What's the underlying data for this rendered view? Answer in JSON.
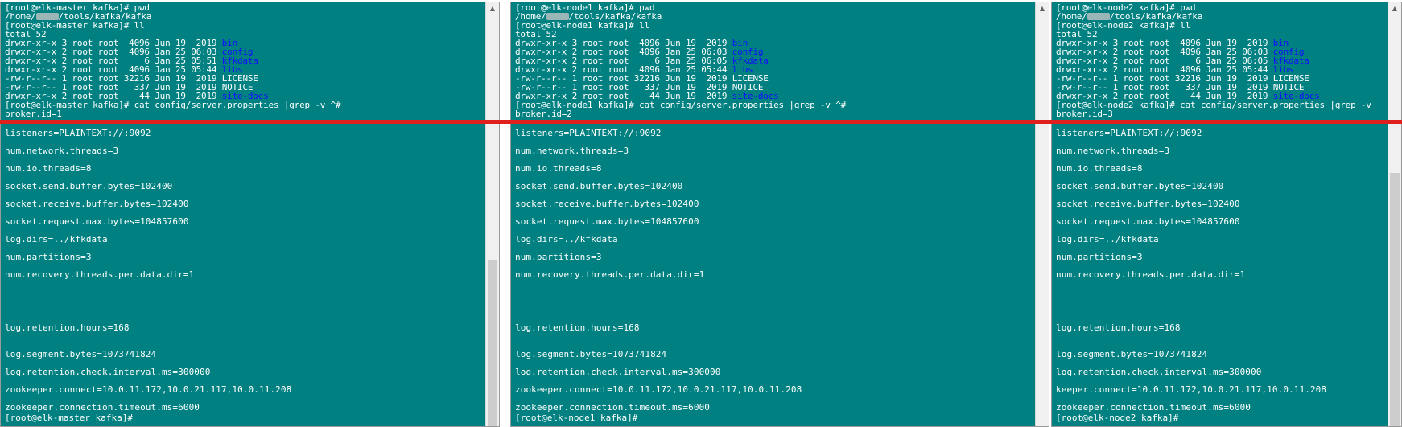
{
  "panes": [
    {
      "host": "elk-master",
      "header": [
        {
          "t": "[root@elk-master kafka]# pwd"
        },
        {
          "t": "/home/",
          "blur": true,
          "t2": "/tools/kafka/kafka"
        },
        {
          "t": "[root@elk-master kafka]# ll"
        },
        {
          "t": "total 52"
        },
        {
          "t": "drwxr-xr-x 3 root root  4096 Jun 19  2019 ",
          "name": "bin"
        },
        {
          "t": "drwxr-xr-x 2 root root  4096 Jan 25 06:03 ",
          "name": "config"
        },
        {
          "t": "drwxr-xr-x 2 root root     6 Jan 25 05:51 ",
          "name": "kfkdata"
        },
        {
          "t": "drwxr-xr-x 2 root root  4096 Jan 25 05:44 ",
          "name": "libs"
        },
        {
          "t": "-rw-r--r-- 1 root root 32216 Jun 19  2019 LICENSE"
        },
        {
          "t": "-rw-r--r-- 1 root root   337 Jun 19  2019 NOTICE"
        },
        {
          "t": "drwxr-xr-x 2 root root    44 Jun 19  2019 ",
          "name": "site-docs"
        },
        {
          "t": "[root@elk-master kafka]# cat config/server.properties |grep -v ^#"
        },
        {
          "t": "broker.id=1"
        }
      ],
      "props": [
        "listeners=PLAINTEXT://:9092",
        "num.network.threads=3",
        "num.io.threads=8",
        "socket.send.buffer.bytes=102400",
        "socket.receive.buffer.bytes=102400",
        "socket.request.max.bytes=104857600",
        "log.dirs=../kfkdata",
        "num.partitions=3",
        "num.recovery.threads.per.data.dir=1",
        "log.retention.hours=168",
        "log.segment.bytes=1073741824",
        "log.retention.check.interval.ms=300000",
        "zookeeper.connect=10.0.11.172,10.0.21.117,10.0.11.208",
        "zookeeper.connection.timeout.ms=6000"
      ],
      "tail": "[root@elk-master kafka]#",
      "scroll_position": 0.62
    },
    {
      "host": "elk-node1",
      "header": [
        {
          "t": "[root@elk-node1 kafka]# pwd"
        },
        {
          "t": "/home/",
          "blur": true,
          "t2": "/tools/kafka/kafka"
        },
        {
          "t": "[root@elk-node1 kafka]# ll"
        },
        {
          "t": "total 52"
        },
        {
          "t": "drwxr-xr-x 3 root root  4096 Jun 19  2019 ",
          "name": "bin"
        },
        {
          "t": "drwxr-xr-x 2 root root  4096 Jan 25 06:03 ",
          "name": "config"
        },
        {
          "t": "drwxr-xr-x 2 root root     6 Jan 25 06:05 ",
          "name": "kfkdata"
        },
        {
          "t": "drwxr-xr-x 2 root root  4096 Jan 25 05:44 ",
          "name": "libs"
        },
        {
          "t": "-rw-r--r-- 1 root root 32216 Jun 19  2019 LICENSE"
        },
        {
          "t": "-rw-r--r-- 1 root root   337 Jun 19  2019 NOTICE"
        },
        {
          "t": "drwxr-xr-x 2 root root    44 Jun 19  2019 ",
          "name": "site-docs"
        },
        {
          "t": "[root@elk-node1 kafka]# cat config/server.properties |grep -v ^#"
        },
        {
          "t": "broker.id=2"
        }
      ],
      "props": [
        "listeners=PLAINTEXT://:9092",
        "num.network.threads=3",
        "num.io.threads=8",
        "socket.send.buffer.bytes=102400",
        "socket.receive.buffer.bytes=102400",
        "socket.request.max.bytes=104857600",
        "log.dirs=../kfkdata",
        "num.partitions=3",
        "num.recovery.threads.per.data.dir=1",
        "log.retention.hours=168",
        "log.segment.bytes=1073741824",
        "log.retention.check.interval.ms=300000",
        "zookeeper.connect=10.0.11.172,10.0.21.117,10.0.11.208",
        "zookeeper.connection.timeout.ms=6000"
      ],
      "tail": "[root@elk-node1 kafka]#",
      "scroll_position": 0.0
    },
    {
      "host": "elk-node2",
      "header": [
        {
          "t": "[root@elk-node2 kafka]# pwd"
        },
        {
          "t": "/home/",
          "blur": true,
          "t2": "/tools/kafka/kafka"
        },
        {
          "t": "[root@elk-node2 kafka]# ll"
        },
        {
          "t": "total 52"
        },
        {
          "t": "drwxr-xr-x 3 root root  4096 Jun 19  2019 ",
          "name": "bin"
        },
        {
          "t": "drwxr-xr-x 2 root root  4096 Jan 25 06:03 ",
          "name": "config"
        },
        {
          "t": "drwxr-xr-x 2 root root     6 Jan 25 06:05 ",
          "name": "kfkdata"
        },
        {
          "t": "drwxr-xr-x 2 root root  4096 Jan 25 05:44 ",
          "name": "libs"
        },
        {
          "t": "-rw-r--r-- 1 root root 32216 Jun 19  2019 LICENSE"
        },
        {
          "t": "-rw-r--r-- 1 root root   337 Jun 19  2019 NOTICE"
        },
        {
          "t": "drwxr-xr-x 2 root root    44 Jun 19  2019 ",
          "name": "site-docs"
        },
        {
          "t": "[root@elk-node2 kafka]# cat config/server.properties |grep -v"
        },
        {
          "t": "broker.id=3"
        }
      ],
      "props": [
        "listeners=PLAINTEXT://:9092",
        "num.network.threads=3",
        "num.io.threads=8",
        "socket.send.buffer.bytes=102400",
        "socket.receive.buffer.bytes=102400",
        "socket.request.max.bytes=104857600",
        "log.dirs=../kfkdata",
        "num.partitions=3",
        "num.recovery.threads.per.data.dir=1",
        "log.retention.hours=168",
        "log.segment.bytes=1073741824",
        "log.retention.check.interval.ms=300000",
        "keeper.connect=10.0.11.172,10.0.21.117,10.0.11.208",
        "zookeeper.connection.timeout.ms=6000"
      ],
      "tail": "[root@elk-node2 kafka]#",
      "scroll_position": 0.35
    }
  ],
  "colors": {
    "terminal_bg": "#008080",
    "terminal_fg": "#ffffff",
    "dir_name": "#1010ff",
    "separator": "#e0201c"
  }
}
